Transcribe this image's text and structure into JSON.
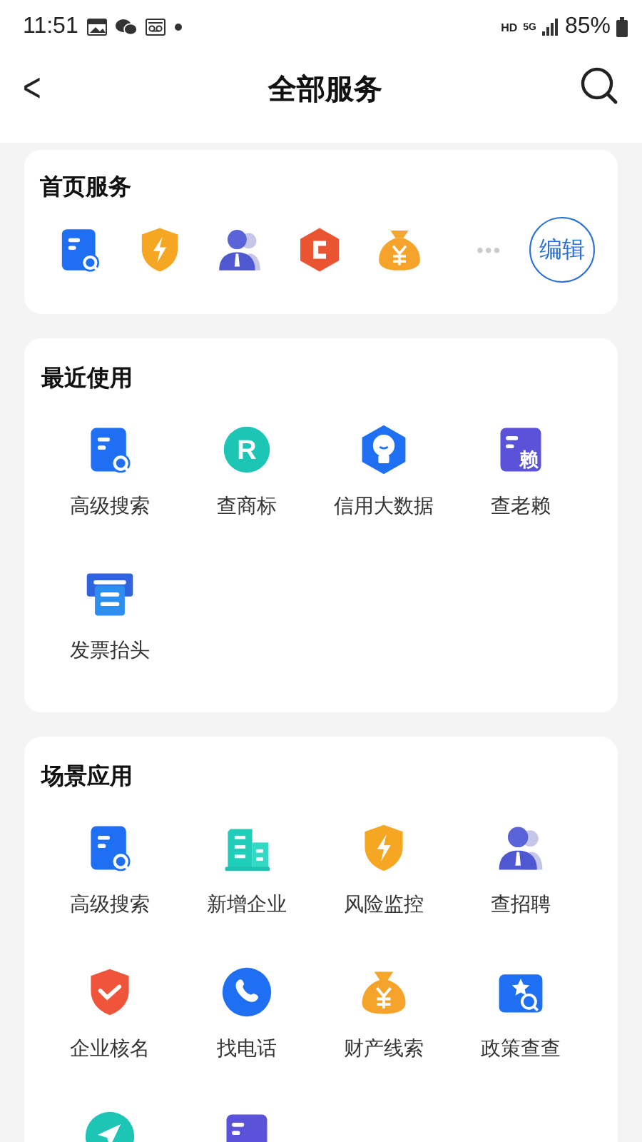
{
  "status_bar": {
    "time": "11:51",
    "network": "HD",
    "signal_type": "5G",
    "battery": "85%"
  },
  "header": {
    "back": "<",
    "title": "全部服务"
  },
  "home_services": {
    "title": "首页服务",
    "icons": [
      {
        "kind": "search-doc"
      },
      {
        "kind": "shield-bolt"
      },
      {
        "kind": "person"
      },
      {
        "kind": "hex-c"
      },
      {
        "kind": "money-bag"
      }
    ],
    "more": "•••",
    "edit_button": "编辑"
  },
  "sections": [
    {
      "title": "最近使用",
      "items": [
        {
          "label": "高级搜索",
          "kind": "search-doc"
        },
        {
          "label": "查商标",
          "kind": "r-circle",
          "icon_text": "R"
        },
        {
          "label": "信用大数据",
          "kind": "hex-bulb"
        },
        {
          "label": "查老赖",
          "kind": "doc-text",
          "icon_text": "赖"
        },
        {
          "label": "发票抬头",
          "kind": "invoice"
        }
      ]
    },
    {
      "title": "场景应用",
      "items": [
        {
          "label": "高级搜索",
          "kind": "search-doc"
        },
        {
          "label": "新增企业",
          "kind": "building"
        },
        {
          "label": "风险监控",
          "kind": "shield-bolt"
        },
        {
          "label": "查招聘",
          "kind": "person"
        },
        {
          "label": "企业核名",
          "kind": "shield-check"
        },
        {
          "label": "找电话",
          "kind": "phone"
        },
        {
          "label": "财产线索",
          "kind": "money-bag"
        },
        {
          "label": "政策查查",
          "kind": "star-folder"
        },
        {
          "kind": "nav-circle"
        },
        {
          "kind": "doc-plain"
        }
      ]
    }
  ]
}
